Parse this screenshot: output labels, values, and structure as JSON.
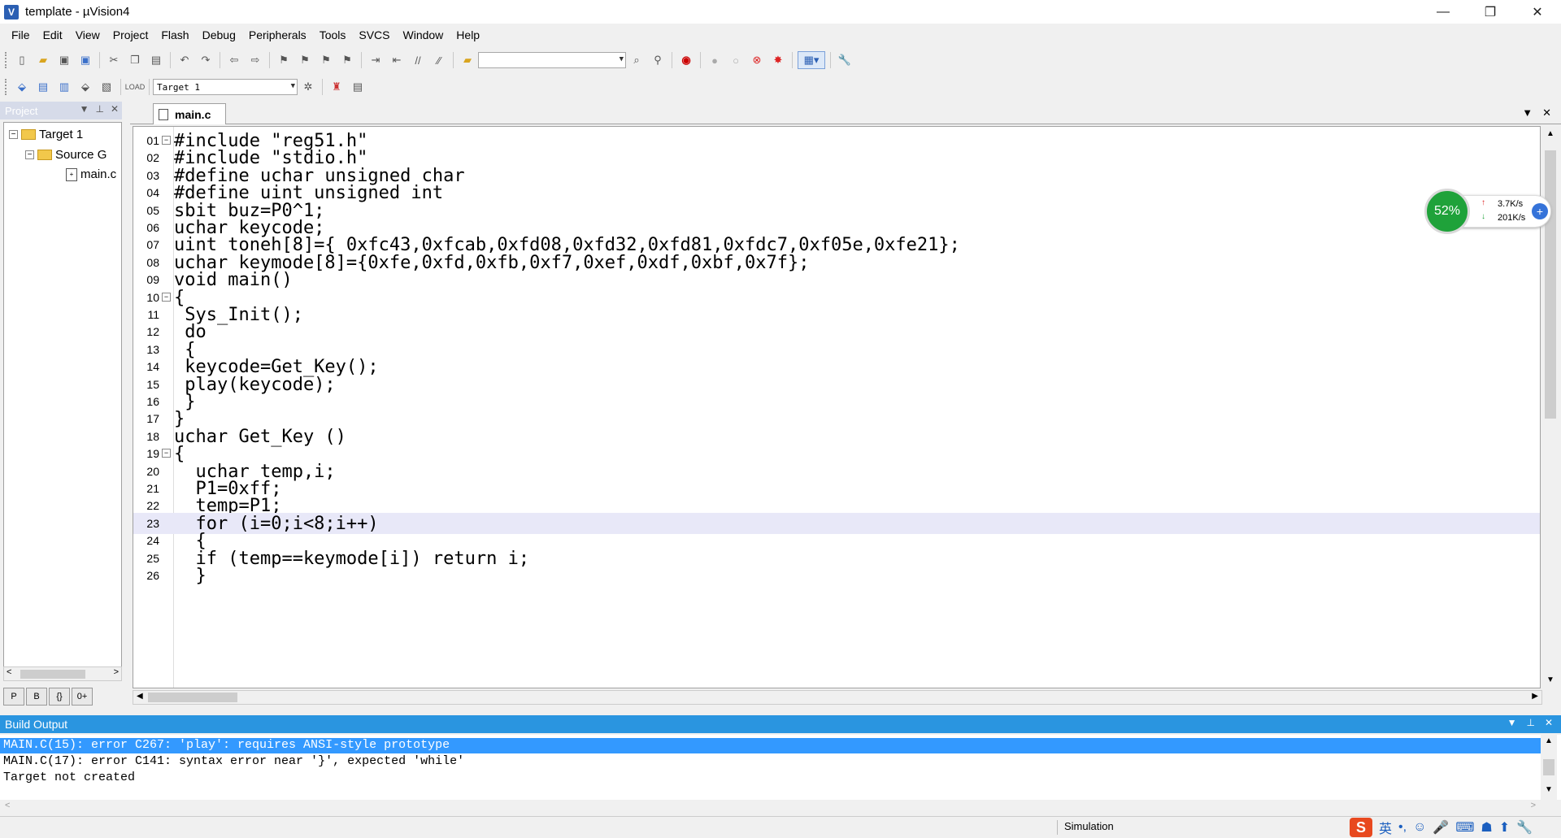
{
  "window": {
    "title": "template - µVision4",
    "app_icon": "V",
    "controls": {
      "minimize": "—",
      "restore": "❐",
      "close": "✕"
    }
  },
  "menu": [
    "File",
    "Edit",
    "View",
    "Project",
    "Flash",
    "Debug",
    "Peripherals",
    "Tools",
    "SVCS",
    "Window",
    "Help"
  ],
  "toolbar": {
    "find_combo_value": "",
    "target_combo_value": "Target 1"
  },
  "project": {
    "header": "Project",
    "tree": {
      "target": "Target 1",
      "group": "Source G",
      "file": "main.c"
    },
    "tabs": [
      "P",
      "B",
      "{}",
      "0+"
    ]
  },
  "editor": {
    "tab": "main.c",
    "current_line": 23,
    "lines": [
      {
        "no": "01",
        "fold": "−",
        "code": "#include \"reg51.h\""
      },
      {
        "no": "02",
        "fold": "",
        "code": "#include \"stdio.h\""
      },
      {
        "no": "03",
        "fold": "",
        "code": "#define uchar unsigned char"
      },
      {
        "no": "04",
        "fold": "",
        "code": "#define uint unsigned int"
      },
      {
        "no": "05",
        "fold": "",
        "code": "sbit buz=P0^1;"
      },
      {
        "no": "06",
        "fold": "",
        "code": "uchar keycode;"
      },
      {
        "no": "07",
        "fold": "",
        "code": "uint toneh[8]={ 0xfc43,0xfcab,0xfd08,0xfd32,0xfd81,0xfdc7,0xf05e,0xfe21};"
      },
      {
        "no": "08",
        "fold": "",
        "code": "uchar keymode[8]={0xfe,0xfd,0xfb,0xf7,0xef,0xdf,0xbf,0x7f};"
      },
      {
        "no": "09",
        "fold": "",
        "code": "void main()"
      },
      {
        "no": "10",
        "fold": "−",
        "code": "{"
      },
      {
        "no": "11",
        "fold": "",
        "code": " Sys_Init();"
      },
      {
        "no": "12",
        "fold": "",
        "code": " do"
      },
      {
        "no": "13",
        "fold": "",
        "code": " {"
      },
      {
        "no": "14",
        "fold": "",
        "code": " keycode=Get_Key();"
      },
      {
        "no": "15",
        "fold": "",
        "code": " play(keycode);"
      },
      {
        "no": "16",
        "fold": "",
        "code": " }"
      },
      {
        "no": "17",
        "fold": "",
        "code": "}"
      },
      {
        "no": "18",
        "fold": "",
        "code": "uchar Get_Key ()"
      },
      {
        "no": "19",
        "fold": "−",
        "code": "{"
      },
      {
        "no": "20",
        "fold": "",
        "code": "  uchar temp,i;"
      },
      {
        "no": "21",
        "fold": "",
        "code": "  P1=0xff;"
      },
      {
        "no": "22",
        "fold": "",
        "code": "  temp=P1;"
      },
      {
        "no": "23",
        "fold": "",
        "code": "  for (i=0;i<8;i++)"
      },
      {
        "no": "24",
        "fold": "",
        "code": "  {"
      },
      {
        "no": "25",
        "fold": "",
        "code": "  if (temp==keymode[i]) return i;"
      },
      {
        "no": "26",
        "fold": "",
        "code": "  }"
      }
    ]
  },
  "network_widget": {
    "percent": "52%",
    "upload": "3.7K/s",
    "download": "201K/s"
  },
  "build_output": {
    "header": "Build Output",
    "lines": [
      "MAIN.C(15): error C267: 'play': requires ANSI-style prototype",
      "MAIN.C(17): error C141: syntax error near '}', expected 'while'",
      "Target not created"
    ],
    "selected_index": 0
  },
  "status": {
    "mode": "Simulation",
    "ime_lang": "英"
  }
}
